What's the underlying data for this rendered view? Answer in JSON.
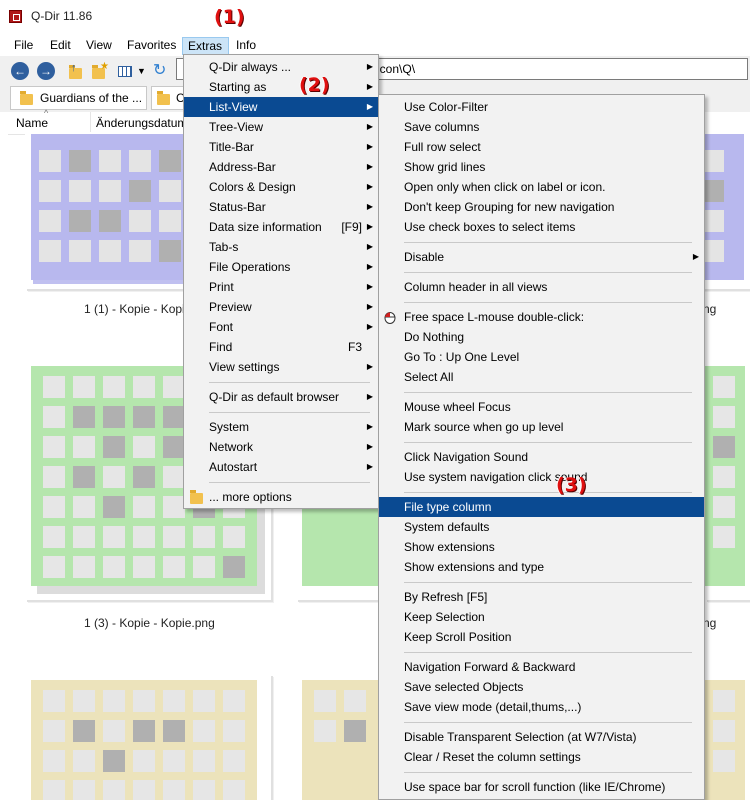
{
  "window": {
    "title": "Q-Dir 11.86"
  },
  "menubar": {
    "items": [
      "File",
      "Edit",
      "View",
      "Favorites",
      "Extras",
      "Info"
    ]
  },
  "toolbar": {
    "address_value": "g\\icon\\Q\\"
  },
  "tabs": [
    {
      "label": "Guardians of the ..."
    },
    {
      "label": "C"
    }
  ],
  "columns": {
    "name": "Name",
    "modified": "Änderungsdatum"
  },
  "thumbnails": {
    "labels": [
      "1 (1) - Kopie - Kopi",
      "ng",
      "1 (3) - Kopie - Kopie.png",
      "ng"
    ],
    "colors": {
      "blue": "#b8b8ee",
      "green": "#b5e6ad",
      "beige": "#ece3bb",
      "gray": "#b0b0b0"
    }
  },
  "extras_menu": {
    "items": [
      {
        "label": "Q-Dir always ...",
        "sub": true
      },
      {
        "label": "Starting as",
        "sub": true
      },
      {
        "label": "List-View",
        "sub": true,
        "highlighted": true
      },
      {
        "label": "Tree-View",
        "sub": true
      },
      {
        "label": "Title-Bar",
        "sub": true
      },
      {
        "label": "Address-Bar",
        "sub": true
      },
      {
        "label": "Colors & Design",
        "sub": true
      },
      {
        "label": "Status-Bar",
        "sub": true
      },
      {
        "label": "Data size information",
        "shortcut": "[F9]",
        "sub": true
      },
      {
        "label": "Tab-s",
        "sub": true
      },
      {
        "label": "File Operations",
        "sub": true
      },
      {
        "label": "Print",
        "sub": true
      },
      {
        "label": "Preview",
        "sub": true
      },
      {
        "label": "Font",
        "sub": true
      },
      {
        "label": "Find",
        "shortcut": "F3"
      },
      {
        "label": "View settings",
        "sub": true
      },
      {
        "separator": true
      },
      {
        "label": "Q-Dir as default browser",
        "sub": true
      },
      {
        "separator": true
      },
      {
        "label": "System",
        "sub": true
      },
      {
        "label": "Network",
        "sub": true
      },
      {
        "label": "Autostart",
        "sub": true
      },
      {
        "separator": true
      },
      {
        "label": "... more options",
        "icon": "folder-icon"
      }
    ]
  },
  "listview_menu": {
    "items": [
      {
        "label": "Use Color-Filter"
      },
      {
        "label": "Save columns"
      },
      {
        "label": "Full row select"
      },
      {
        "label": "Show grid lines"
      },
      {
        "label": "Open only when click on label or icon."
      },
      {
        "label": "Don't keep Grouping for new navigation"
      },
      {
        "label": "Use check boxes to select items"
      },
      {
        "separator": true
      },
      {
        "label": "Disable",
        "sub": true
      },
      {
        "separator": true
      },
      {
        "label": "Column header in all views"
      },
      {
        "separator": true
      },
      {
        "label": "Free space L-mouse double-click:",
        "icon": "mouse-icon"
      },
      {
        "label": "Do Nothing"
      },
      {
        "label": "Go To : Up One Level"
      },
      {
        "label": "Select All"
      },
      {
        "separator": true
      },
      {
        "label": "Mouse wheel Focus"
      },
      {
        "label": "Mark source when go up level"
      },
      {
        "separator": true
      },
      {
        "label": "Click Navigation Sound"
      },
      {
        "label": "Use system navigation click sound"
      },
      {
        "separator": true
      },
      {
        "label": "File type column",
        "highlighted": true
      },
      {
        "label": "System defaults"
      },
      {
        "label": "Show extensions"
      },
      {
        "label": "Show extensions and type"
      },
      {
        "separator": true
      },
      {
        "label": "By Refresh [F5]"
      },
      {
        "label": "Keep Selection"
      },
      {
        "label": "Keep Scroll Position"
      },
      {
        "separator": true
      },
      {
        "label": "Navigation Forward & Backward"
      },
      {
        "label": "Save selected Objects"
      },
      {
        "label": "Save view mode (detail,thums,...)"
      },
      {
        "separator": true
      },
      {
        "label": "Disable Transparent Selection (at W7/Vista)"
      },
      {
        "label": "Clear / Reset the column settings"
      },
      {
        "separator": true
      },
      {
        "label": "Use space bar for scroll function (like IE/Chrome)"
      }
    ]
  },
  "annotations": [
    "(1)",
    "(2)",
    "(3)"
  ],
  "colors": {
    "menu_highlight": "#0a4a92",
    "annotation": "#e01010"
  }
}
